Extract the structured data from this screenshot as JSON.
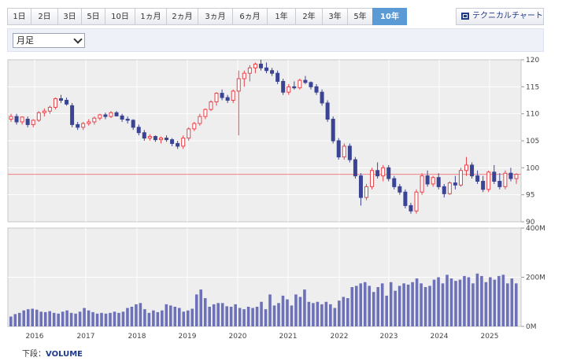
{
  "tabs": [
    {
      "label": "1日",
      "active": false
    },
    {
      "label": "2日",
      "active": false
    },
    {
      "label": "3日",
      "active": false
    },
    {
      "label": "5日",
      "active": false
    },
    {
      "label": "10日",
      "active": false
    },
    {
      "label": "1ヵ月",
      "active": false
    },
    {
      "label": "2ヵ月",
      "active": false
    },
    {
      "label": "3ヵ月",
      "active": false
    },
    {
      "label": "6ヵ月",
      "active": false
    },
    {
      "label": "1年",
      "active": false
    },
    {
      "label": "2年",
      "active": false
    },
    {
      "label": "3年",
      "active": false
    },
    {
      "label": "5年",
      "active": false
    },
    {
      "label": "10年",
      "active": true
    }
  ],
  "tech_button": "テクニカルチャート",
  "period_select": "月足",
  "footer": {
    "prefix": "下段：",
    "name": "VOLUME"
  },
  "colors": {
    "up": "#e8424a",
    "down": "#3b4494",
    "volume": "#6d72b8",
    "refline": "#f08080",
    "grid": "#ffffff",
    "plot_bg": "#eeeeee"
  },
  "chart_data": [
    {
      "type": "candlestick",
      "ylim": [
        90,
        120
      ],
      "y_ticks": [
        "90",
        "95",
        "100",
        "105",
        "110",
        "115",
        "120"
      ],
      "x_labels": [
        "2016",
        "2017",
        "2018",
        "2019",
        "2020",
        "2021",
        "2022",
        "2023",
        "2024",
        "2025"
      ],
      "reference_line": 98.8,
      "candles": [
        [
          109,
          110,
          108.5,
          109.5
        ],
        [
          109.5,
          110,
          108,
          108.5
        ],
        [
          108.5,
          109.5,
          108,
          109.4
        ],
        [
          109,
          109.5,
          107.5,
          108
        ],
        [
          108,
          109,
          107.5,
          108.8
        ],
        [
          108.8,
          110.5,
          108.5,
          110.2
        ],
        [
          110.2,
          111,
          109.5,
          110.5
        ],
        [
          110.5,
          111.5,
          110,
          111.2
        ],
        [
          111.2,
          113,
          110.8,
          112.8
        ],
        [
          112.8,
          113.5,
          112,
          112.5
        ],
        [
          112.5,
          113,
          111.5,
          111.8
        ],
        [
          111.5,
          112,
          107.5,
          108
        ],
        [
          108,
          108.5,
          107,
          107.5
        ],
        [
          107.5,
          108.5,
          107,
          108.2
        ],
        [
          108.2,
          109,
          107.8,
          108.5
        ],
        [
          108.5,
          109.5,
          108,
          109.2
        ],
        [
          109.2,
          110,
          108.8,
          109.8
        ],
        [
          109.8,
          110.2,
          109,
          109.5
        ],
        [
          109.5,
          110.5,
          109.2,
          110.2
        ],
        [
          110.2,
          110.5,
          109.5,
          109.6
        ],
        [
          109.6,
          110,
          108.5,
          109
        ],
        [
          109,
          109.5,
          108.2,
          108.8
        ],
        [
          108.8,
          109,
          107,
          107.5
        ],
        [
          107.5,
          108,
          106,
          106.5
        ],
        [
          106.5,
          107,
          105,
          105.5
        ],
        [
          105.5,
          106.2,
          105,
          105.8
        ],
        [
          105.8,
          106,
          104.8,
          105.2
        ],
        [
          105.2,
          105.8,
          104.5,
          105.5
        ],
        [
          105.5,
          106,
          104.8,
          105.2
        ],
        [
          105.2,
          105.5,
          104,
          104.5
        ],
        [
          104.5,
          105,
          103.5,
          104
        ],
        [
          104,
          106,
          103.5,
          105.5
        ],
        [
          105.5,
          107.5,
          105,
          107.2
        ],
        [
          107.2,
          108.5,
          106.8,
          108.2
        ],
        [
          108.2,
          110,
          107.8,
          109.5
        ],
        [
          109.5,
          111,
          109,
          110.8
        ],
        [
          110.8,
          112.5,
          110.5,
          112.2
        ],
        [
          112.2,
          114,
          111.5,
          113.8
        ],
        [
          113.8,
          114.5,
          112.5,
          113
        ],
        [
          113,
          113.5,
          112,
          112.5
        ],
        [
          112.5,
          114.5,
          112,
          114.2
        ],
        [
          114.2,
          118,
          106,
          116.5
        ],
        [
          116.5,
          118,
          115,
          117.5
        ],
        [
          117.5,
          119,
          116,
          118.5
        ],
        [
          118.5,
          119.5,
          117.5,
          119.2
        ],
        [
          119.2,
          120,
          118,
          118.5
        ],
        [
          118.5,
          119.5,
          117.5,
          118
        ],
        [
          118,
          118.5,
          117,
          117.5
        ],
        [
          117.5,
          118,
          115.5,
          116
        ],
        [
          116,
          116.5,
          113.5,
          114
        ],
        [
          114,
          115.5,
          113.5,
          115
        ],
        [
          115,
          116,
          114.5,
          114.8
        ],
        [
          114.8,
          116.5,
          114.5,
          116.2
        ],
        [
          116.2,
          117,
          115.5,
          115.8
        ],
        [
          115.8,
          116,
          114.5,
          115
        ],
        [
          115,
          115.5,
          113.5,
          114
        ],
        [
          114,
          114.5,
          111.5,
          112
        ],
        [
          112,
          112.5,
          108.5,
          109
        ],
        [
          109,
          109.5,
          104.5,
          105
        ],
        [
          105,
          105.5,
          101.5,
          102
        ],
        [
          102,
          104.5,
          101.5,
          104
        ],
        [
          104,
          104.5,
          101,
          101.5
        ],
        [
          101.5,
          102,
          98,
          98.5
        ],
        [
          98.5,
          99,
          93,
          94.5
        ],
        [
          94.5,
          97,
          94,
          96.5
        ],
        [
          96.5,
          100,
          96,
          99.5
        ],
        [
          99.5,
          101,
          98,
          98.5
        ],
        [
          98.5,
          100.5,
          97.5,
          100
        ],
        [
          100,
          100.5,
          97.5,
          98
        ],
        [
          98,
          98.5,
          96,
          96.5
        ],
        [
          96.5,
          97,
          95,
          95.5
        ],
        [
          95.5,
          96,
          92.5,
          93
        ],
        [
          93,
          93.5,
          91.5,
          92
        ],
        [
          92,
          96,
          91.5,
          95.5
        ],
        [
          95.5,
          99,
          95,
          98.5
        ],
        [
          98.5,
          99.5,
          96.5,
          97
        ],
        [
          97,
          98.5,
          96.5,
          98.2
        ],
        [
          98.2,
          99,
          96,
          96.5
        ],
        [
          96.5,
          97,
          94.5,
          95.2
        ],
        [
          95.2,
          97.5,
          95,
          97.2
        ],
        [
          97.2,
          98.5,
          96,
          96.8
        ],
        [
          96.8,
          100,
          96.5,
          99.5
        ],
        [
          99.5,
          102,
          98.5,
          100.5
        ],
        [
          100.5,
          101,
          98,
          98.5
        ],
        [
          98.5,
          99.5,
          97,
          97.5
        ],
        [
          97.5,
          98.5,
          95.5,
          96
        ],
        [
          96,
          99.5,
          95.5,
          99.2
        ],
        [
          99.2,
          100.5,
          97,
          97.5
        ],
        [
          97.5,
          99,
          96,
          96.5
        ],
        [
          96.5,
          99.5,
          96,
          99
        ],
        [
          99,
          100,
          97.5,
          98
        ],
        [
          98,
          99,
          97,
          98.8
        ]
      ]
    },
    {
      "type": "bar",
      "ylim": [
        0,
        400
      ],
      "y_ticks": [
        "0M",
        "200M",
        "400M"
      ],
      "values": [
        40,
        50,
        55,
        65,
        70,
        72,
        68,
        60,
        58,
        62,
        55,
        52,
        60,
        65,
        55,
        52,
        60,
        75,
        65,
        58,
        52,
        55,
        52,
        55,
        60,
        55,
        60,
        75,
        80,
        90,
        95,
        70,
        55,
        65,
        58,
        65,
        90,
        85,
        80,
        75,
        60,
        65,
        72,
        130,
        150,
        115,
        80,
        90,
        95,
        95,
        82,
        80,
        90,
        75,
        70,
        80,
        75,
        80,
        100,
        70,
        130,
        85,
        95,
        125,
        110,
        85,
        130,
        120,
        150,
        100,
        95,
        100,
        90,
        100,
        90,
        75,
        105,
        120,
        115,
        160,
        165,
        175,
        180,
        165,
        140,
        160,
        175,
        125,
        180,
        145,
        165,
        175,
        170,
        180,
        195,
        175,
        160,
        165,
        190,
        200,
        175,
        210,
        195,
        185,
        190,
        205,
        200,
        175,
        215,
        205,
        180,
        200,
        190,
        205,
        210,
        175,
        195,
        175
      ]
    }
  ]
}
